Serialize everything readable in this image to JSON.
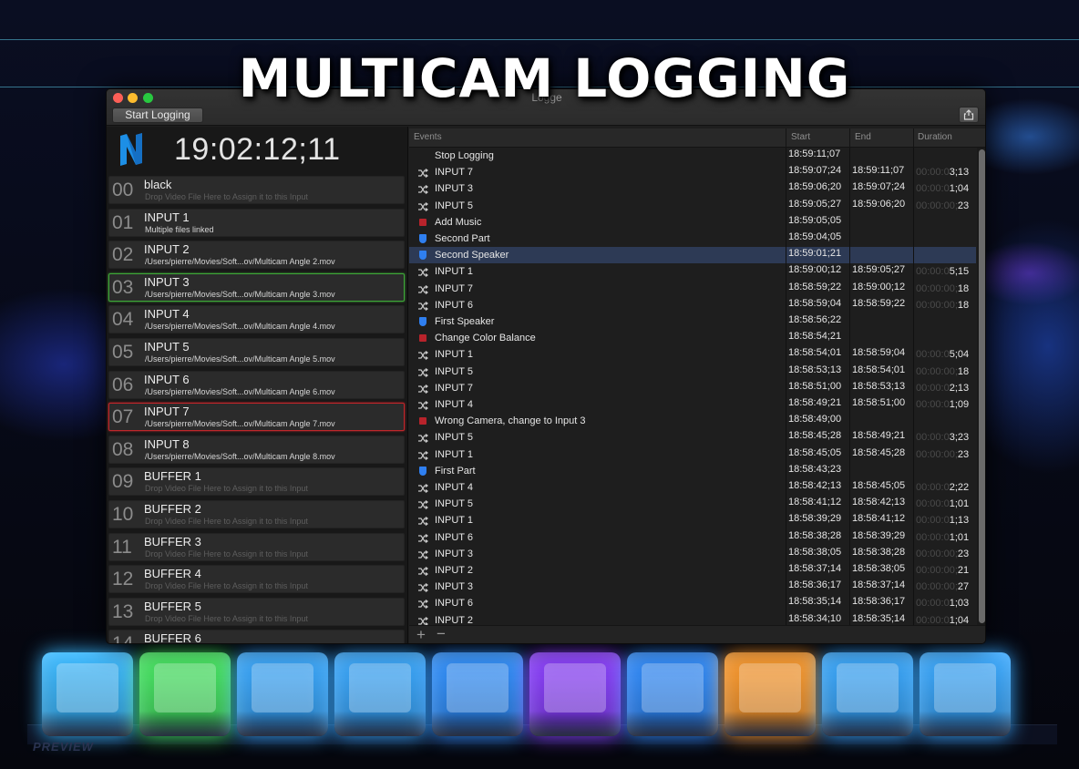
{
  "headline": "MULTICAM LOGGING",
  "window": {
    "title": "Logge",
    "start_logging_label": "Start Logging",
    "share_icon": "share-icon"
  },
  "timecode": "19:02:12;11",
  "inputs": [
    {
      "num": "00",
      "name": "black",
      "sub": "Drop Video File Here to Assign it to this Input",
      "hint": true,
      "state": ""
    },
    {
      "num": "01",
      "name": "INPUT 1",
      "sub": "Multiple files linked",
      "hint": false,
      "state": ""
    },
    {
      "num": "02",
      "name": "INPUT 2",
      "sub": "/Users/pierre/Movies/Soft...ov/Multicam Angle 2.mov",
      "hint": false,
      "state": ""
    },
    {
      "num": "03",
      "name": "INPUT 3",
      "sub": "/Users/pierre/Movies/Soft...ov/Multicam Angle 3.mov",
      "hint": false,
      "state": "green"
    },
    {
      "num": "04",
      "name": "INPUT 4",
      "sub": "/Users/pierre/Movies/Soft...ov/Multicam Angle 4.mov",
      "hint": false,
      "state": ""
    },
    {
      "num": "05",
      "name": "INPUT 5",
      "sub": "/Users/pierre/Movies/Soft...ov/Multicam Angle 5.mov",
      "hint": false,
      "state": ""
    },
    {
      "num": "06",
      "name": "INPUT 6",
      "sub": "/Users/pierre/Movies/Soft...ov/Multicam Angle 6.mov",
      "hint": false,
      "state": ""
    },
    {
      "num": "07",
      "name": "INPUT 7",
      "sub": "/Users/pierre/Movies/Soft...ov/Multicam Angle 7.mov",
      "hint": false,
      "state": "red"
    },
    {
      "num": "08",
      "name": "INPUT 8",
      "sub": "/Users/pierre/Movies/Soft...ov/Multicam Angle 8.mov",
      "hint": false,
      "state": ""
    },
    {
      "num": "09",
      "name": "BUFFER 1",
      "sub": "Drop Video File Here to Assign it to this Input",
      "hint": true,
      "state": ""
    },
    {
      "num": "10",
      "name": "BUFFER 2",
      "sub": "Drop Video File Here to Assign it to this Input",
      "hint": true,
      "state": ""
    },
    {
      "num": "11",
      "name": "BUFFER 3",
      "sub": "Drop Video File Here to Assign it to this Input",
      "hint": true,
      "state": ""
    },
    {
      "num": "12",
      "name": "BUFFER 4",
      "sub": "Drop Video File Here to Assign it to this Input",
      "hint": true,
      "state": ""
    },
    {
      "num": "13",
      "name": "BUFFER 5",
      "sub": "Drop Video File Here to Assign it to this Input",
      "hint": true,
      "state": ""
    },
    {
      "num": "14",
      "name": "BUFFER 6",
      "sub": "",
      "hint": true,
      "state": ""
    }
  ],
  "table": {
    "headers": {
      "events": "Events",
      "start": "Start",
      "end": "End",
      "duration": "Duration"
    },
    "rows": [
      {
        "type": "none",
        "name": "Stop Logging",
        "start": "18:59:11;07",
        "end": "",
        "dur_dim": "",
        "dur": ""
      },
      {
        "type": "switch",
        "name": "INPUT 7",
        "start": "18:59:07;24",
        "end": "18:59:11;07",
        "dur_dim": "00:00:0",
        "dur": "3;13"
      },
      {
        "type": "switch",
        "name": "INPUT 3",
        "start": "18:59:06;20",
        "end": "18:59:07;24",
        "dur_dim": "00:00:0",
        "dur": "1;04"
      },
      {
        "type": "switch",
        "name": "INPUT 5",
        "start": "18:59:05;27",
        "end": "18:59:06;20",
        "dur_dim": "00:00:00;",
        "dur": "23"
      },
      {
        "type": "red",
        "name": "Add Music",
        "start": "18:59:05;05",
        "end": "",
        "dur_dim": "",
        "dur": ""
      },
      {
        "type": "blue",
        "name": "Second Part",
        "start": "18:59:04;05",
        "end": "",
        "dur_dim": "",
        "dur": ""
      },
      {
        "type": "blue",
        "name": "Second Speaker",
        "start": "18:59:01;21",
        "end": "",
        "dur_dim": "",
        "dur": "",
        "selected": true
      },
      {
        "type": "switch",
        "name": "INPUT 1",
        "start": "18:59:00;12",
        "end": "18:59:05;27",
        "dur_dim": "00:00:0",
        "dur": "5;15"
      },
      {
        "type": "switch",
        "name": "INPUT 7",
        "start": "18:58:59;22",
        "end": "18:59:00;12",
        "dur_dim": "00:00:00;",
        "dur": "18"
      },
      {
        "type": "switch",
        "name": "INPUT 6",
        "start": "18:58:59;04",
        "end": "18:58:59;22",
        "dur_dim": "00:00:00;",
        "dur": "18"
      },
      {
        "type": "blue",
        "name": "First Speaker",
        "start": "18:58:56;22",
        "end": "",
        "dur_dim": "",
        "dur": ""
      },
      {
        "type": "red",
        "name": "Change Color Balance",
        "start": "18:58:54;21",
        "end": "",
        "dur_dim": "",
        "dur": ""
      },
      {
        "type": "switch",
        "name": "INPUT 1",
        "start": "18:58:54;01",
        "end": "18:58:59;04",
        "dur_dim": "00:00:0",
        "dur": "5;04"
      },
      {
        "type": "switch",
        "name": "INPUT 5",
        "start": "18:58:53;13",
        "end": "18:58:54;01",
        "dur_dim": "00:00:00;",
        "dur": "18"
      },
      {
        "type": "switch",
        "name": "INPUT 7",
        "start": "18:58:51;00",
        "end": "18:58:53;13",
        "dur_dim": "00:00:0",
        "dur": "2;13"
      },
      {
        "type": "switch",
        "name": "INPUT 4",
        "start": "18:58:49;21",
        "end": "18:58:51;00",
        "dur_dim": "00:00:0",
        "dur": "1;09"
      },
      {
        "type": "red",
        "name": "Wrong Camera, change to Input 3",
        "start": "18:58:49;00",
        "end": "",
        "dur_dim": "",
        "dur": ""
      },
      {
        "type": "switch",
        "name": "INPUT 5",
        "start": "18:58:45;28",
        "end": "18:58:49;21",
        "dur_dim": "00:00:0",
        "dur": "3;23"
      },
      {
        "type": "switch",
        "name": "INPUT 1",
        "start": "18:58:45;05",
        "end": "18:58:45;28",
        "dur_dim": "00:00:00;",
        "dur": "23"
      },
      {
        "type": "blue",
        "name": "First Part",
        "start": "18:58:43;23",
        "end": "",
        "dur_dim": "",
        "dur": ""
      },
      {
        "type": "switch",
        "name": "INPUT 4",
        "start": "18:58:42;13",
        "end": "18:58:45;05",
        "dur_dim": "00:00:0",
        "dur": "2;22"
      },
      {
        "type": "switch",
        "name": "INPUT 5",
        "start": "18:58:41;12",
        "end": "18:58:42;13",
        "dur_dim": "00:00:0",
        "dur": "1;01"
      },
      {
        "type": "switch",
        "name": "INPUT 1",
        "start": "18:58:39;29",
        "end": "18:58:41;12",
        "dur_dim": "00:00:0",
        "dur": "1;13"
      },
      {
        "type": "switch",
        "name": "INPUT 6",
        "start": "18:58:38;28",
        "end": "18:58:39;29",
        "dur_dim": "00:00:0",
        "dur": "1;01"
      },
      {
        "type": "switch",
        "name": "INPUT 3",
        "start": "18:58:38;05",
        "end": "18:58:38;28",
        "dur_dim": "00:00:00;",
        "dur": "23"
      },
      {
        "type": "switch",
        "name": "INPUT 2",
        "start": "18:58:37;14",
        "end": "18:58:38;05",
        "dur_dim": "00:00:00;",
        "dur": "21"
      },
      {
        "type": "switch",
        "name": "INPUT 3",
        "start": "18:58:36;17",
        "end": "18:58:37;14",
        "dur_dim": "00:00:00;",
        "dur": "27"
      },
      {
        "type": "switch",
        "name": "INPUT 6",
        "start": "18:58:35;14",
        "end": "18:58:36;17",
        "dur_dim": "00:00:0",
        "dur": "1;03"
      },
      {
        "type": "switch",
        "name": "INPUT 2",
        "start": "18:58:34;10",
        "end": "18:58:35;14",
        "dur_dim": "00:00:0",
        "dur": "1;04"
      }
    ]
  },
  "footer": {
    "add_label": "+",
    "remove_label": "−"
  },
  "keys": [
    {
      "color": "#38b8ff"
    },
    {
      "color": "#44e860"
    },
    {
      "color": "#37a8ff"
    },
    {
      "color": "#37a8ff"
    },
    {
      "color": "#2e90ff"
    },
    {
      "color": "#8a3cff"
    },
    {
      "color": "#2e8cff"
    },
    {
      "color": "#ff9a2a"
    },
    {
      "color": "#37a8ff"
    },
    {
      "color": "#37a8ff"
    }
  ],
  "preview_label": "PREVIEW",
  "colors": {
    "selection_green": "#3fa838",
    "selection_red": "#c0262a",
    "row_selected": "#2d3a55",
    "marker_red": "#b8232b",
    "marker_blue": "#2f7ff0"
  }
}
